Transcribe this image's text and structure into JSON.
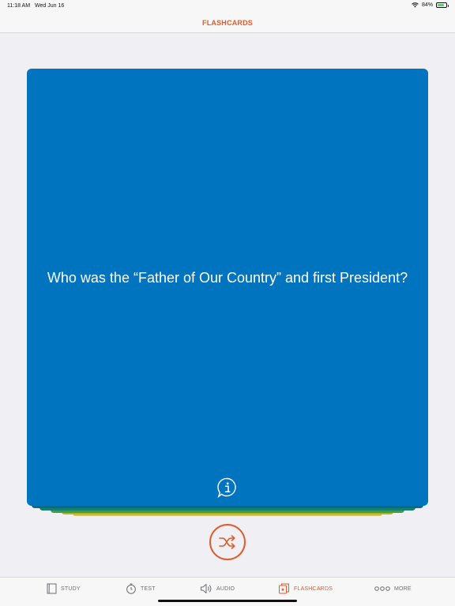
{
  "status": {
    "time": "11:18 AM",
    "date": "Wed Jun 16",
    "battery_percent": "84%",
    "battery_level": 0.84
  },
  "nav": {
    "title": "FLASHCARDS"
  },
  "card": {
    "question": "Who was the “Father of Our Country” and first President?",
    "color": "#0174bf"
  },
  "tabs": [
    {
      "label": "STUDY",
      "icon": "book-icon"
    },
    {
      "label": "TEST",
      "icon": "stopwatch-icon"
    },
    {
      "label": "AUDIO",
      "icon": "speaker-icon"
    },
    {
      "label": "FLASHCARDS",
      "icon": "flashcards-icon",
      "active": true
    },
    {
      "label": "MORE",
      "icon": "more-icon"
    }
  ],
  "accent_color": "#e25b2b"
}
